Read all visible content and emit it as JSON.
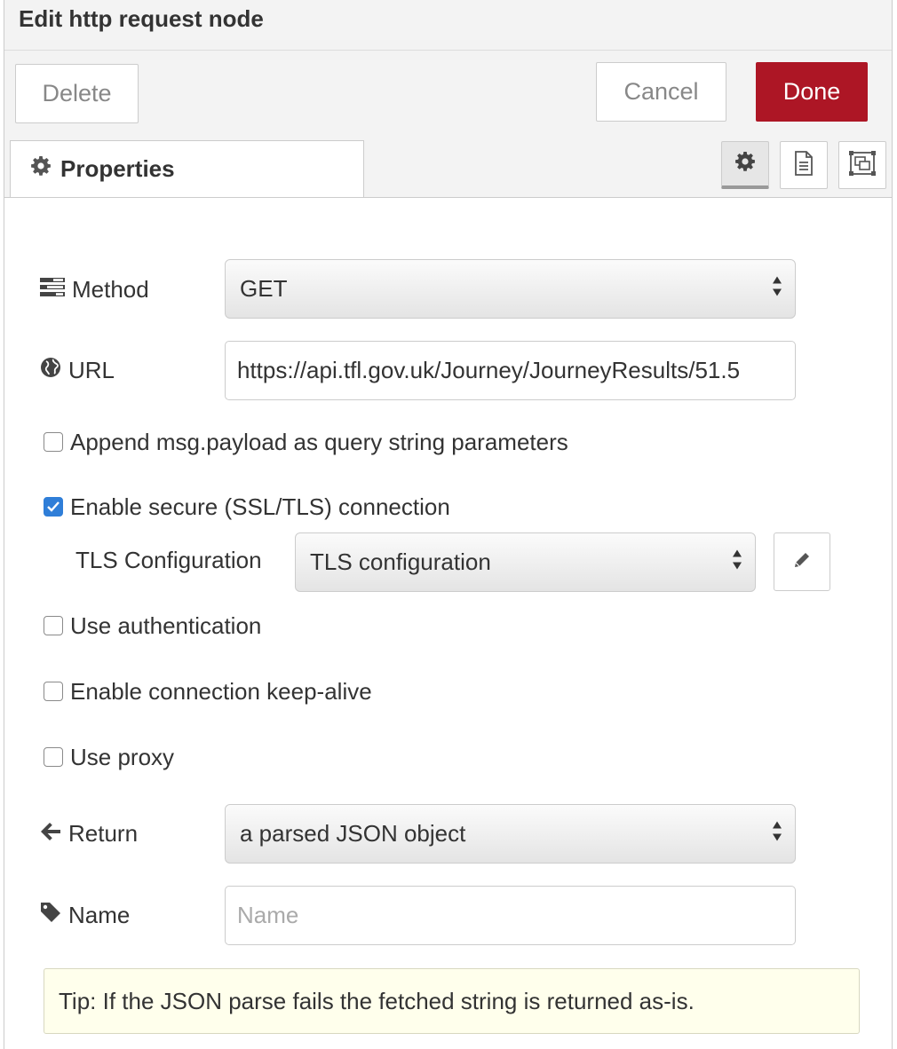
{
  "dialog": {
    "title": "Edit http request node"
  },
  "toolbar": {
    "delete_label": "Delete",
    "cancel_label": "Cancel",
    "done_label": "Done"
  },
  "tabs": {
    "properties_label": "Properties"
  },
  "form": {
    "method": {
      "label": "Method",
      "value": "GET"
    },
    "url": {
      "label": "URL",
      "value": "https://api.tfl.gov.uk/Journey/JourneyResults/51.5"
    },
    "append_payload": {
      "label": "Append msg.payload as query string parameters",
      "checked": false
    },
    "enable_tls": {
      "label": "Enable secure (SSL/TLS) connection",
      "checked": true
    },
    "tls_config": {
      "label": "TLS Configuration",
      "value": "TLS configuration"
    },
    "use_auth": {
      "label": "Use authentication",
      "checked": false
    },
    "keep_alive": {
      "label": "Enable connection keep-alive",
      "checked": false
    },
    "use_proxy": {
      "label": "Use proxy",
      "checked": false
    },
    "return": {
      "label": "Return",
      "value": "a parsed JSON object"
    },
    "name": {
      "label": "Name",
      "placeholder": "Name",
      "value": ""
    }
  },
  "tip": {
    "text": "Tip: If the JSON parse fails the fetched string is returned as-is."
  },
  "colors": {
    "primary": "#ad1625",
    "checkbox_checked": "#2f7ed8",
    "tip_bg": "#ffffec"
  },
  "icons": {
    "tab_properties": "gear-icon",
    "tab_side_settings": "gear-icon",
    "tab_side_description": "file-text-icon",
    "tab_side_appearance": "object-group-icon",
    "method": "tasks-icon",
    "url": "globe-icon",
    "tls_edit": "pencil-icon",
    "return": "arrow-left-icon",
    "name": "tag-icon"
  }
}
